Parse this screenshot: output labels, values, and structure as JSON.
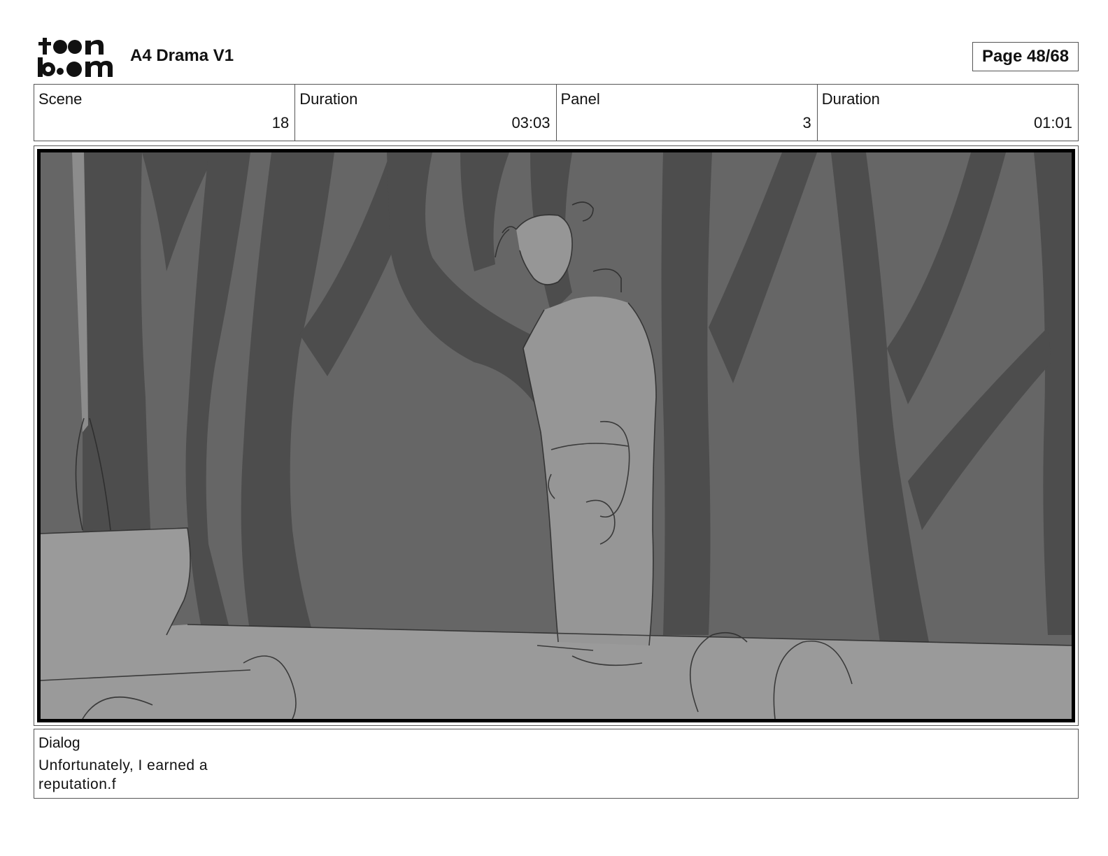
{
  "header": {
    "logo_text_top": "toon",
    "logo_text_bottom": "boom",
    "title": "A4 Drama V1",
    "page_label": "Page 48/68"
  },
  "info": {
    "scene_label": "Scene",
    "scene_value": "18",
    "scene_duration_label": "Duration",
    "scene_duration_value": "03:03",
    "panel_label": "Panel",
    "panel_value": "3",
    "panel_duration_label": "Duration",
    "panel_duration_value": "01:01"
  },
  "dialog": {
    "label": "Dialog",
    "text": "Unfortunately, I earned a reputation.f"
  }
}
